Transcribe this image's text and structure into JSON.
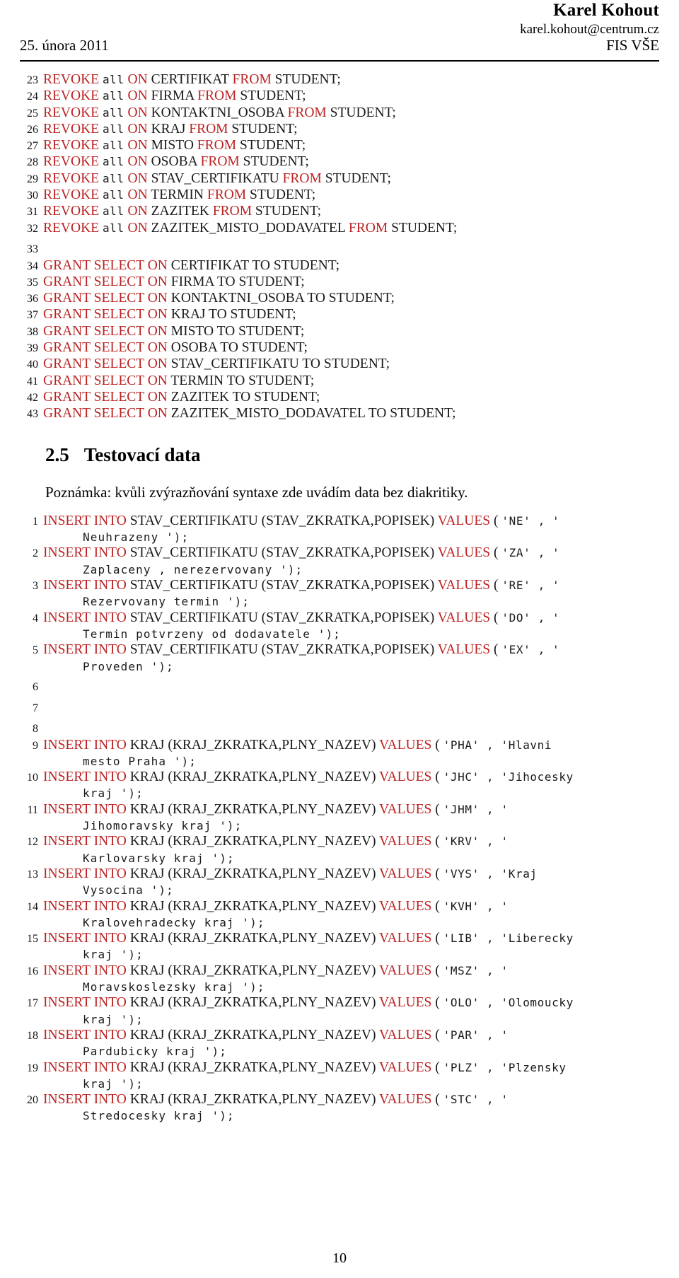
{
  "header": {
    "author": "Karel Kohout",
    "email": "karel.kohout@centrum.cz",
    "date": "25. února 2011",
    "affiliation": "FIS VŠE"
  },
  "listing_top": {
    "lines": [
      {
        "no": "23",
        "parts": [
          {
            "t": "REVOKE",
            "s": "kw"
          },
          {
            "t": " ",
            "s": "id"
          },
          {
            "t": "all",
            "s": "tt"
          },
          {
            "t": " ",
            "s": "id"
          },
          {
            "t": "ON",
            "s": "kw"
          },
          {
            "t": " CERTIFIKAT ",
            "s": "id"
          },
          {
            "t": "FROM",
            "s": "kw"
          },
          {
            "t": " STUDENT;",
            "s": "id"
          }
        ]
      },
      {
        "no": "24",
        "parts": [
          {
            "t": "REVOKE",
            "s": "kw"
          },
          {
            "t": " ",
            "s": "id"
          },
          {
            "t": "all",
            "s": "tt"
          },
          {
            "t": " ",
            "s": "id"
          },
          {
            "t": "ON",
            "s": "kw"
          },
          {
            "t": " FIRMA ",
            "s": "id"
          },
          {
            "t": "FROM",
            "s": "kw"
          },
          {
            "t": " STUDENT;",
            "s": "id"
          }
        ]
      },
      {
        "no": "25",
        "parts": [
          {
            "t": "REVOKE",
            "s": "kw"
          },
          {
            "t": " ",
            "s": "id"
          },
          {
            "t": "all",
            "s": "tt"
          },
          {
            "t": " ",
            "s": "id"
          },
          {
            "t": "ON",
            "s": "kw"
          },
          {
            "t": " KONTAKTNI_OSOBA ",
            "s": "id"
          },
          {
            "t": "FROM",
            "s": "kw"
          },
          {
            "t": " STUDENT;",
            "s": "id"
          }
        ]
      },
      {
        "no": "26",
        "parts": [
          {
            "t": "REVOKE",
            "s": "kw"
          },
          {
            "t": " ",
            "s": "id"
          },
          {
            "t": "all",
            "s": "tt"
          },
          {
            "t": " ",
            "s": "id"
          },
          {
            "t": "ON",
            "s": "kw"
          },
          {
            "t": " KRAJ ",
            "s": "id"
          },
          {
            "t": "FROM",
            "s": "kw"
          },
          {
            "t": " STUDENT;",
            "s": "id"
          }
        ]
      },
      {
        "no": "27",
        "parts": [
          {
            "t": "REVOKE",
            "s": "kw"
          },
          {
            "t": " ",
            "s": "id"
          },
          {
            "t": "all",
            "s": "tt"
          },
          {
            "t": " ",
            "s": "id"
          },
          {
            "t": "ON",
            "s": "kw"
          },
          {
            "t": " MISTO ",
            "s": "id"
          },
          {
            "t": "FROM",
            "s": "kw"
          },
          {
            "t": " STUDENT;",
            "s": "id"
          }
        ]
      },
      {
        "no": "28",
        "parts": [
          {
            "t": "REVOKE",
            "s": "kw"
          },
          {
            "t": " ",
            "s": "id"
          },
          {
            "t": "all",
            "s": "tt"
          },
          {
            "t": " ",
            "s": "id"
          },
          {
            "t": "ON",
            "s": "kw"
          },
          {
            "t": " OSOBA ",
            "s": "id"
          },
          {
            "t": "FROM",
            "s": "kw"
          },
          {
            "t": " STUDENT;",
            "s": "id"
          }
        ]
      },
      {
        "no": "29",
        "parts": [
          {
            "t": "REVOKE",
            "s": "kw"
          },
          {
            "t": " ",
            "s": "id"
          },
          {
            "t": "all",
            "s": "tt"
          },
          {
            "t": " ",
            "s": "id"
          },
          {
            "t": "ON",
            "s": "kw"
          },
          {
            "t": " STAV_CERTIFIKATU ",
            "s": "id"
          },
          {
            "t": "FROM",
            "s": "kw"
          },
          {
            "t": " STUDENT;",
            "s": "id"
          }
        ]
      },
      {
        "no": "30",
        "parts": [
          {
            "t": "REVOKE",
            "s": "kw"
          },
          {
            "t": " ",
            "s": "id"
          },
          {
            "t": "all",
            "s": "tt"
          },
          {
            "t": " ",
            "s": "id"
          },
          {
            "t": "ON",
            "s": "kw"
          },
          {
            "t": " TERMIN ",
            "s": "id"
          },
          {
            "t": "FROM",
            "s": "kw"
          },
          {
            "t": " STUDENT;",
            "s": "id"
          }
        ]
      },
      {
        "no": "31",
        "parts": [
          {
            "t": "REVOKE",
            "s": "kw"
          },
          {
            "t": " ",
            "s": "id"
          },
          {
            "t": "all",
            "s": "tt"
          },
          {
            "t": " ",
            "s": "id"
          },
          {
            "t": "ON",
            "s": "kw"
          },
          {
            "t": " ZAZITEK ",
            "s": "id"
          },
          {
            "t": "FROM",
            "s": "kw"
          },
          {
            "t": " STUDENT;",
            "s": "id"
          }
        ]
      },
      {
        "no": "32",
        "parts": [
          {
            "t": "REVOKE",
            "s": "kw"
          },
          {
            "t": " ",
            "s": "id"
          },
          {
            "t": "all",
            "s": "tt"
          },
          {
            "t": " ",
            "s": "id"
          },
          {
            "t": "ON",
            "s": "kw"
          },
          {
            "t": " ZAZITEK_MISTO_DODAVATEL ",
            "s": "id"
          },
          {
            "t": "FROM",
            "s": "kw"
          },
          {
            "t": " STUDENT;",
            "s": "id"
          }
        ]
      },
      {
        "no": "33",
        "parts": []
      },
      {
        "no": "34",
        "parts": [
          {
            "t": "GRANT SELECT ON",
            "s": "kw"
          },
          {
            "t": " CERTIFIKAT TO STUDENT;",
            "s": "id"
          }
        ]
      },
      {
        "no": "35",
        "parts": [
          {
            "t": "GRANT SELECT ON",
            "s": "kw"
          },
          {
            "t": " FIRMA TO STUDENT;",
            "s": "id"
          }
        ]
      },
      {
        "no": "36",
        "parts": [
          {
            "t": "GRANT SELECT ON",
            "s": "kw"
          },
          {
            "t": " KONTAKTNI_OSOBA TO STUDENT;",
            "s": "id"
          }
        ]
      },
      {
        "no": "37",
        "parts": [
          {
            "t": "GRANT SELECT ON",
            "s": "kw"
          },
          {
            "t": " KRAJ TO STUDENT;",
            "s": "id"
          }
        ]
      },
      {
        "no": "38",
        "parts": [
          {
            "t": "GRANT SELECT ON",
            "s": "kw"
          },
          {
            "t": " MISTO TO STUDENT;",
            "s": "id"
          }
        ]
      },
      {
        "no": "39",
        "parts": [
          {
            "t": "GRANT SELECT ON",
            "s": "kw"
          },
          {
            "t": " OSOBA TO STUDENT;",
            "s": "id"
          }
        ]
      },
      {
        "no": "40",
        "parts": [
          {
            "t": "GRANT SELECT ON",
            "s": "kw"
          },
          {
            "t": " STAV_CERTIFIKATU TO STUDENT;",
            "s": "id"
          }
        ]
      },
      {
        "no": "41",
        "parts": [
          {
            "t": "GRANT SELECT ON",
            "s": "kw"
          },
          {
            "t": " TERMIN TO STUDENT;",
            "s": "id"
          }
        ]
      },
      {
        "no": "42",
        "parts": [
          {
            "t": "GRANT SELECT ON",
            "s": "kw"
          },
          {
            "t": " ZAZITEK TO STUDENT;",
            "s": "id"
          }
        ]
      },
      {
        "no": "43",
        "parts": [
          {
            "t": "GRANT SELECT ON",
            "s": "kw"
          },
          {
            "t": " ZAZITEK_MISTO_DODAVATEL TO STUDENT;",
            "s": "id"
          }
        ]
      }
    ]
  },
  "section": {
    "number": "2.5",
    "title": "Testovací data"
  },
  "note": "Poznámka: kvůli zvýrazňování syntaxe zde uvádím data bez diakritiky.",
  "listing_data": {
    "lines": [
      {
        "no": "1",
        "parts": [
          {
            "t": "INSERT INTO",
            "s": "kw"
          },
          {
            "t": " STAV_CERTIFIKATU (STAV_ZKRATKA,POPISEK) ",
            "s": "id"
          },
          {
            "t": "VALUES",
            "s": "kw"
          },
          {
            "t": " ( ",
            "s": "id"
          },
          {
            "t": "'NE' , '",
            "s": "tt"
          }
        ],
        "cont": "Neuhrazeny ');"
      },
      {
        "no": "2",
        "parts": [
          {
            "t": "INSERT INTO",
            "s": "kw"
          },
          {
            "t": " STAV_CERTIFIKATU (STAV_ZKRATKA,POPISEK) ",
            "s": "id"
          },
          {
            "t": "VALUES",
            "s": "kw"
          },
          {
            "t": " ( ",
            "s": "id"
          },
          {
            "t": "'ZA' , '",
            "s": "tt"
          }
        ],
        "cont": "Zaplaceny , nerezervovany ');"
      },
      {
        "no": "3",
        "parts": [
          {
            "t": "INSERT INTO",
            "s": "kw"
          },
          {
            "t": " STAV_CERTIFIKATU (STAV_ZKRATKA,POPISEK) ",
            "s": "id"
          },
          {
            "t": "VALUES",
            "s": "kw"
          },
          {
            "t": " ( ",
            "s": "id"
          },
          {
            "t": "'RE' , '",
            "s": "tt"
          }
        ],
        "cont": "Rezervovany termin ');"
      },
      {
        "no": "4",
        "parts": [
          {
            "t": "INSERT INTO",
            "s": "kw"
          },
          {
            "t": " STAV_CERTIFIKATU (STAV_ZKRATKA,POPISEK) ",
            "s": "id"
          },
          {
            "t": "VALUES",
            "s": "kw"
          },
          {
            "t": " ( ",
            "s": "id"
          },
          {
            "t": "'DO' , '",
            "s": "tt"
          }
        ],
        "cont": "Termin potvrzeny od dodavatele ');"
      },
      {
        "no": "5",
        "parts": [
          {
            "t": "INSERT INTO",
            "s": "kw"
          },
          {
            "t": " STAV_CERTIFIKATU (STAV_ZKRATKA,POPISEK) ",
            "s": "id"
          },
          {
            "t": "VALUES",
            "s": "kw"
          },
          {
            "t": " ( ",
            "s": "id"
          },
          {
            "t": "'EX' , '",
            "s": "tt"
          }
        ],
        "cont": "Proveden ');"
      },
      {
        "no": "6",
        "parts": []
      },
      {
        "no": "7",
        "parts": []
      },
      {
        "no": "8",
        "parts": []
      },
      {
        "no": "9",
        "parts": [
          {
            "t": "INSERT INTO",
            "s": "kw"
          },
          {
            "t": " KRAJ (KRAJ_ZKRATKA,PLNY_NAZEV) ",
            "s": "id"
          },
          {
            "t": "VALUES",
            "s": "kw"
          },
          {
            "t": " ( ",
            "s": "id"
          },
          {
            "t": "'PHA' , 'Hlavni",
            "s": "tt"
          }
        ],
        "cont": "mesto Praha ');"
      },
      {
        "no": "10",
        "parts": [
          {
            "t": "INSERT INTO",
            "s": "kw"
          },
          {
            "t": " KRAJ (KRAJ_ZKRATKA,PLNY_NAZEV) ",
            "s": "id"
          },
          {
            "t": "VALUES",
            "s": "kw"
          },
          {
            "t": " ( ",
            "s": "id"
          },
          {
            "t": "'JHC' , 'Jihocesky",
            "s": "tt"
          }
        ],
        "cont": "kraj ');"
      },
      {
        "no": "11",
        "parts": [
          {
            "t": "INSERT INTO",
            "s": "kw"
          },
          {
            "t": " KRAJ (KRAJ_ZKRATKA,PLNY_NAZEV) ",
            "s": "id"
          },
          {
            "t": "VALUES",
            "s": "kw"
          },
          {
            "t": " ( ",
            "s": "id"
          },
          {
            "t": "'JHM' , '",
            "s": "tt"
          }
        ],
        "cont": "Jihomoravsky kraj ');"
      },
      {
        "no": "12",
        "parts": [
          {
            "t": "INSERT INTO",
            "s": "kw"
          },
          {
            "t": " KRAJ (KRAJ_ZKRATKA,PLNY_NAZEV) ",
            "s": "id"
          },
          {
            "t": "VALUES",
            "s": "kw"
          },
          {
            "t": " ( ",
            "s": "id"
          },
          {
            "t": "'KRV' , '",
            "s": "tt"
          }
        ],
        "cont": "Karlovarsky kraj ');"
      },
      {
        "no": "13",
        "parts": [
          {
            "t": "INSERT INTO",
            "s": "kw"
          },
          {
            "t": " KRAJ (KRAJ_ZKRATKA,PLNY_NAZEV) ",
            "s": "id"
          },
          {
            "t": "VALUES",
            "s": "kw"
          },
          {
            "t": " ( ",
            "s": "id"
          },
          {
            "t": "'VYS' , 'Kraj",
            "s": "tt"
          }
        ],
        "cont": "Vysocina ');"
      },
      {
        "no": "14",
        "parts": [
          {
            "t": "INSERT INTO",
            "s": "kw"
          },
          {
            "t": " KRAJ (KRAJ_ZKRATKA,PLNY_NAZEV) ",
            "s": "id"
          },
          {
            "t": "VALUES",
            "s": "kw"
          },
          {
            "t": " ( ",
            "s": "id"
          },
          {
            "t": "'KVH' , '",
            "s": "tt"
          }
        ],
        "cont": "Kralovehradecky kraj ');"
      },
      {
        "no": "15",
        "parts": [
          {
            "t": "INSERT INTO",
            "s": "kw"
          },
          {
            "t": " KRAJ (KRAJ_ZKRATKA,PLNY_NAZEV) ",
            "s": "id"
          },
          {
            "t": "VALUES",
            "s": "kw"
          },
          {
            "t": " ( ",
            "s": "id"
          },
          {
            "t": "'LIB' , 'Liberecky",
            "s": "tt"
          }
        ],
        "cont": "kraj ');"
      },
      {
        "no": "16",
        "parts": [
          {
            "t": "INSERT INTO",
            "s": "kw"
          },
          {
            "t": " KRAJ (KRAJ_ZKRATKA,PLNY_NAZEV) ",
            "s": "id"
          },
          {
            "t": "VALUES",
            "s": "kw"
          },
          {
            "t": " ( ",
            "s": "id"
          },
          {
            "t": "'MSZ' , '",
            "s": "tt"
          }
        ],
        "cont": "Moravskoslezsky kraj ');"
      },
      {
        "no": "17",
        "parts": [
          {
            "t": "INSERT INTO",
            "s": "kw"
          },
          {
            "t": " KRAJ (KRAJ_ZKRATKA,PLNY_NAZEV) ",
            "s": "id"
          },
          {
            "t": "VALUES",
            "s": "kw"
          },
          {
            "t": " ( ",
            "s": "id"
          },
          {
            "t": "'OLO' , 'Olomoucky",
            "s": "tt"
          }
        ],
        "cont": "kraj ');"
      },
      {
        "no": "18",
        "parts": [
          {
            "t": "INSERT INTO",
            "s": "kw"
          },
          {
            "t": " KRAJ (KRAJ_ZKRATKA,PLNY_NAZEV) ",
            "s": "id"
          },
          {
            "t": "VALUES",
            "s": "kw"
          },
          {
            "t": " ( ",
            "s": "id"
          },
          {
            "t": "'PAR' , '",
            "s": "tt"
          }
        ],
        "cont": "Pardubicky kraj ');"
      },
      {
        "no": "19",
        "parts": [
          {
            "t": "INSERT INTO",
            "s": "kw"
          },
          {
            "t": " KRAJ (KRAJ_ZKRATKA,PLNY_NAZEV) ",
            "s": "id"
          },
          {
            "t": "VALUES",
            "s": "kw"
          },
          {
            "t": " ( ",
            "s": "id"
          },
          {
            "t": "'PLZ' , 'Plzensky",
            "s": "tt"
          }
        ],
        "cont": "kraj ');"
      },
      {
        "no": "20",
        "parts": [
          {
            "t": "INSERT INTO",
            "s": "kw"
          },
          {
            "t": " KRAJ (KRAJ_ZKRATKA,PLNY_NAZEV) ",
            "s": "id"
          },
          {
            "t": "VALUES",
            "s": "kw"
          },
          {
            "t": " ( ",
            "s": "id"
          },
          {
            "t": "'STC' , '",
            "s": "tt"
          }
        ],
        "cont": "Stredocesky kraj ');"
      }
    ]
  },
  "footer": {
    "page_number": "10"
  },
  "colors": {
    "keyword": "#bb2222",
    "text": "#000000"
  }
}
